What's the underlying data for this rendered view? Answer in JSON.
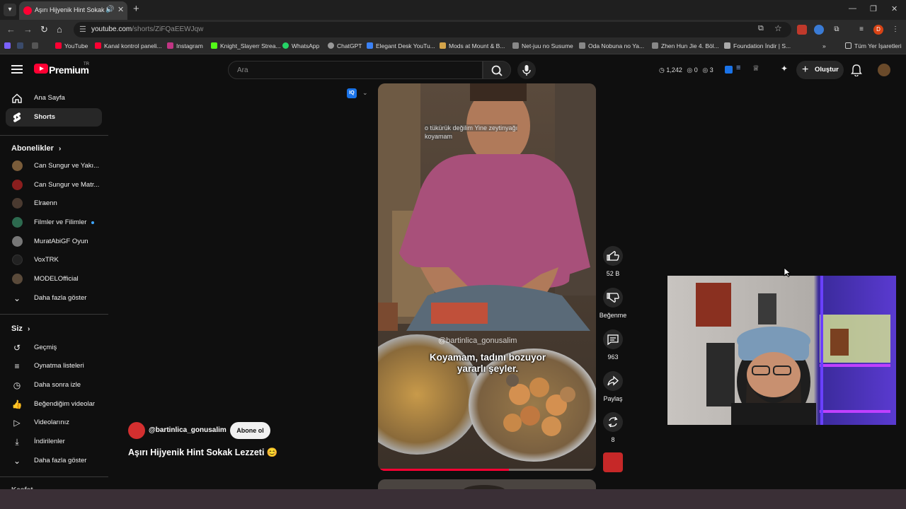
{
  "browser": {
    "tab_title": "Aşırı Hijyenik Hint Sokak Le...",
    "url_host": "youtube.com",
    "url_path": "/shorts/ZiFQaEEWJqw",
    "bookmarks": [
      "YouTube",
      "Kanal kontrol paneli...",
      "Instagram",
      "Knight_Slayerr Strea...",
      "WhatsApp",
      "ChatGPT",
      "Elegant Desk YouTu...",
      "Mods at Mount & B...",
      "Net-juu no Susume",
      "Oda Nobuna no Ya...",
      "Zhen Hun Jie 4. Böl...",
      "Foundation İndir | S..."
    ],
    "all_bookmarks": "Tüm Yer İşaretleri",
    "profile_letter": "D",
    "accent": "#ff0033"
  },
  "masthead": {
    "brand": "Premium",
    "country_code": "TR",
    "search_placeholder": "Ara",
    "stat_views": "1,242",
    "stat_a": "0",
    "stat_b": "3",
    "create_label": "Oluştur"
  },
  "sidebar": {
    "top": [
      {
        "label": "Ana Sayfa",
        "icon": "home-icon"
      },
      {
        "label": "Shorts",
        "icon": "shorts-icon"
      }
    ],
    "subs_title": "Abonelikler",
    "subs": [
      {
        "label": "Can Sungur ve Yakı...",
        "color": "#7a5c3a"
      },
      {
        "label": "Can Sungur ve Matr...",
        "color": "#8b1e1e"
      },
      {
        "label": "Elraenn",
        "color": "#4a3a30"
      },
      {
        "label": "Filmler ve Filimler",
        "color": "#2d6a4f"
      },
      {
        "label": "MuratAbiGF Oyun",
        "color": "#777777"
      },
      {
        "label": "VoxTRK",
        "color": "#222222"
      },
      {
        "label": "MODELOfficial",
        "color": "#5a4a3a"
      }
    ],
    "subs_more": "Daha fazla göster",
    "you_title": "Siz",
    "you": [
      {
        "label": "Geçmiş",
        "icon": "history-icon"
      },
      {
        "label": "Oynatma listeleri",
        "icon": "playlist-icon"
      },
      {
        "label": "Daha sonra izle",
        "icon": "watch-later-icon"
      },
      {
        "label": "Beğendiğim videolar",
        "icon": "like-icon"
      },
      {
        "label": "Videolarınız",
        "icon": "your-videos-icon"
      },
      {
        "label": "İndirilenler",
        "icon": "download-icon"
      }
    ],
    "you_more": "Daha fazla göster",
    "explore_title": "Keşfet"
  },
  "short": {
    "overlay_caption_line1": "o tükürük değilim Yine zeytinyağı",
    "overlay_caption_line2": "koyamam",
    "watermark": "@bartinlica_gonusalim",
    "subtitle_line1": "Koyamam, tadını bozuyor",
    "subtitle_line2": "yararlı şeyler.",
    "progress": 0.6,
    "channel": "@bartinlica_gonusalim",
    "subscribe_label": "Abone ol",
    "title": "Aşırı Hijyenik Hint Sokak Lezzeti 😊"
  },
  "actions": {
    "like_count": "52 B",
    "dislike_label": "Beğenme",
    "comment_count": "963",
    "share_label": "Paylaş",
    "remix_count": "8"
  }
}
